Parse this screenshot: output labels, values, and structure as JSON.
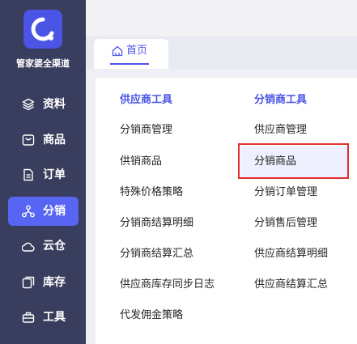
{
  "brand": {
    "name": "管家婆全渠道"
  },
  "sidebar": {
    "items": [
      {
        "label": "资料",
        "icon": "layers-icon"
      },
      {
        "label": "商品",
        "icon": "box-icon"
      },
      {
        "label": "订单",
        "icon": "document-icon"
      },
      {
        "label": "分销",
        "icon": "network-icon",
        "active": true
      },
      {
        "label": "云仓",
        "icon": "cloud-warehouse-icon"
      },
      {
        "label": "库存",
        "icon": "inventory-icon"
      },
      {
        "label": "工具",
        "icon": "toolbox-icon"
      }
    ]
  },
  "tabs": [
    {
      "label": "首页",
      "icon": "home-icon",
      "active": true
    }
  ],
  "columns": [
    {
      "heading": "供应商工具",
      "items": [
        "分销商管理",
        "供销商品",
        "特殊价格策略",
        "分销商结算明细",
        "分销商结算汇总",
        "供应商库存同步日志",
        "代发佣金策略"
      ]
    },
    {
      "heading": "分销商工具",
      "items": [
        "供应商管理",
        "分销商品",
        "分销订单管理",
        "分销售后管理",
        "供应商结算明细",
        "供应商结算汇总"
      ]
    }
  ],
  "colors": {
    "accent": "#4a55e6",
    "sidebar_bg": "#3a3e5e",
    "active_nav": "#5865f2",
    "highlight_border": "#e02f2f"
  }
}
